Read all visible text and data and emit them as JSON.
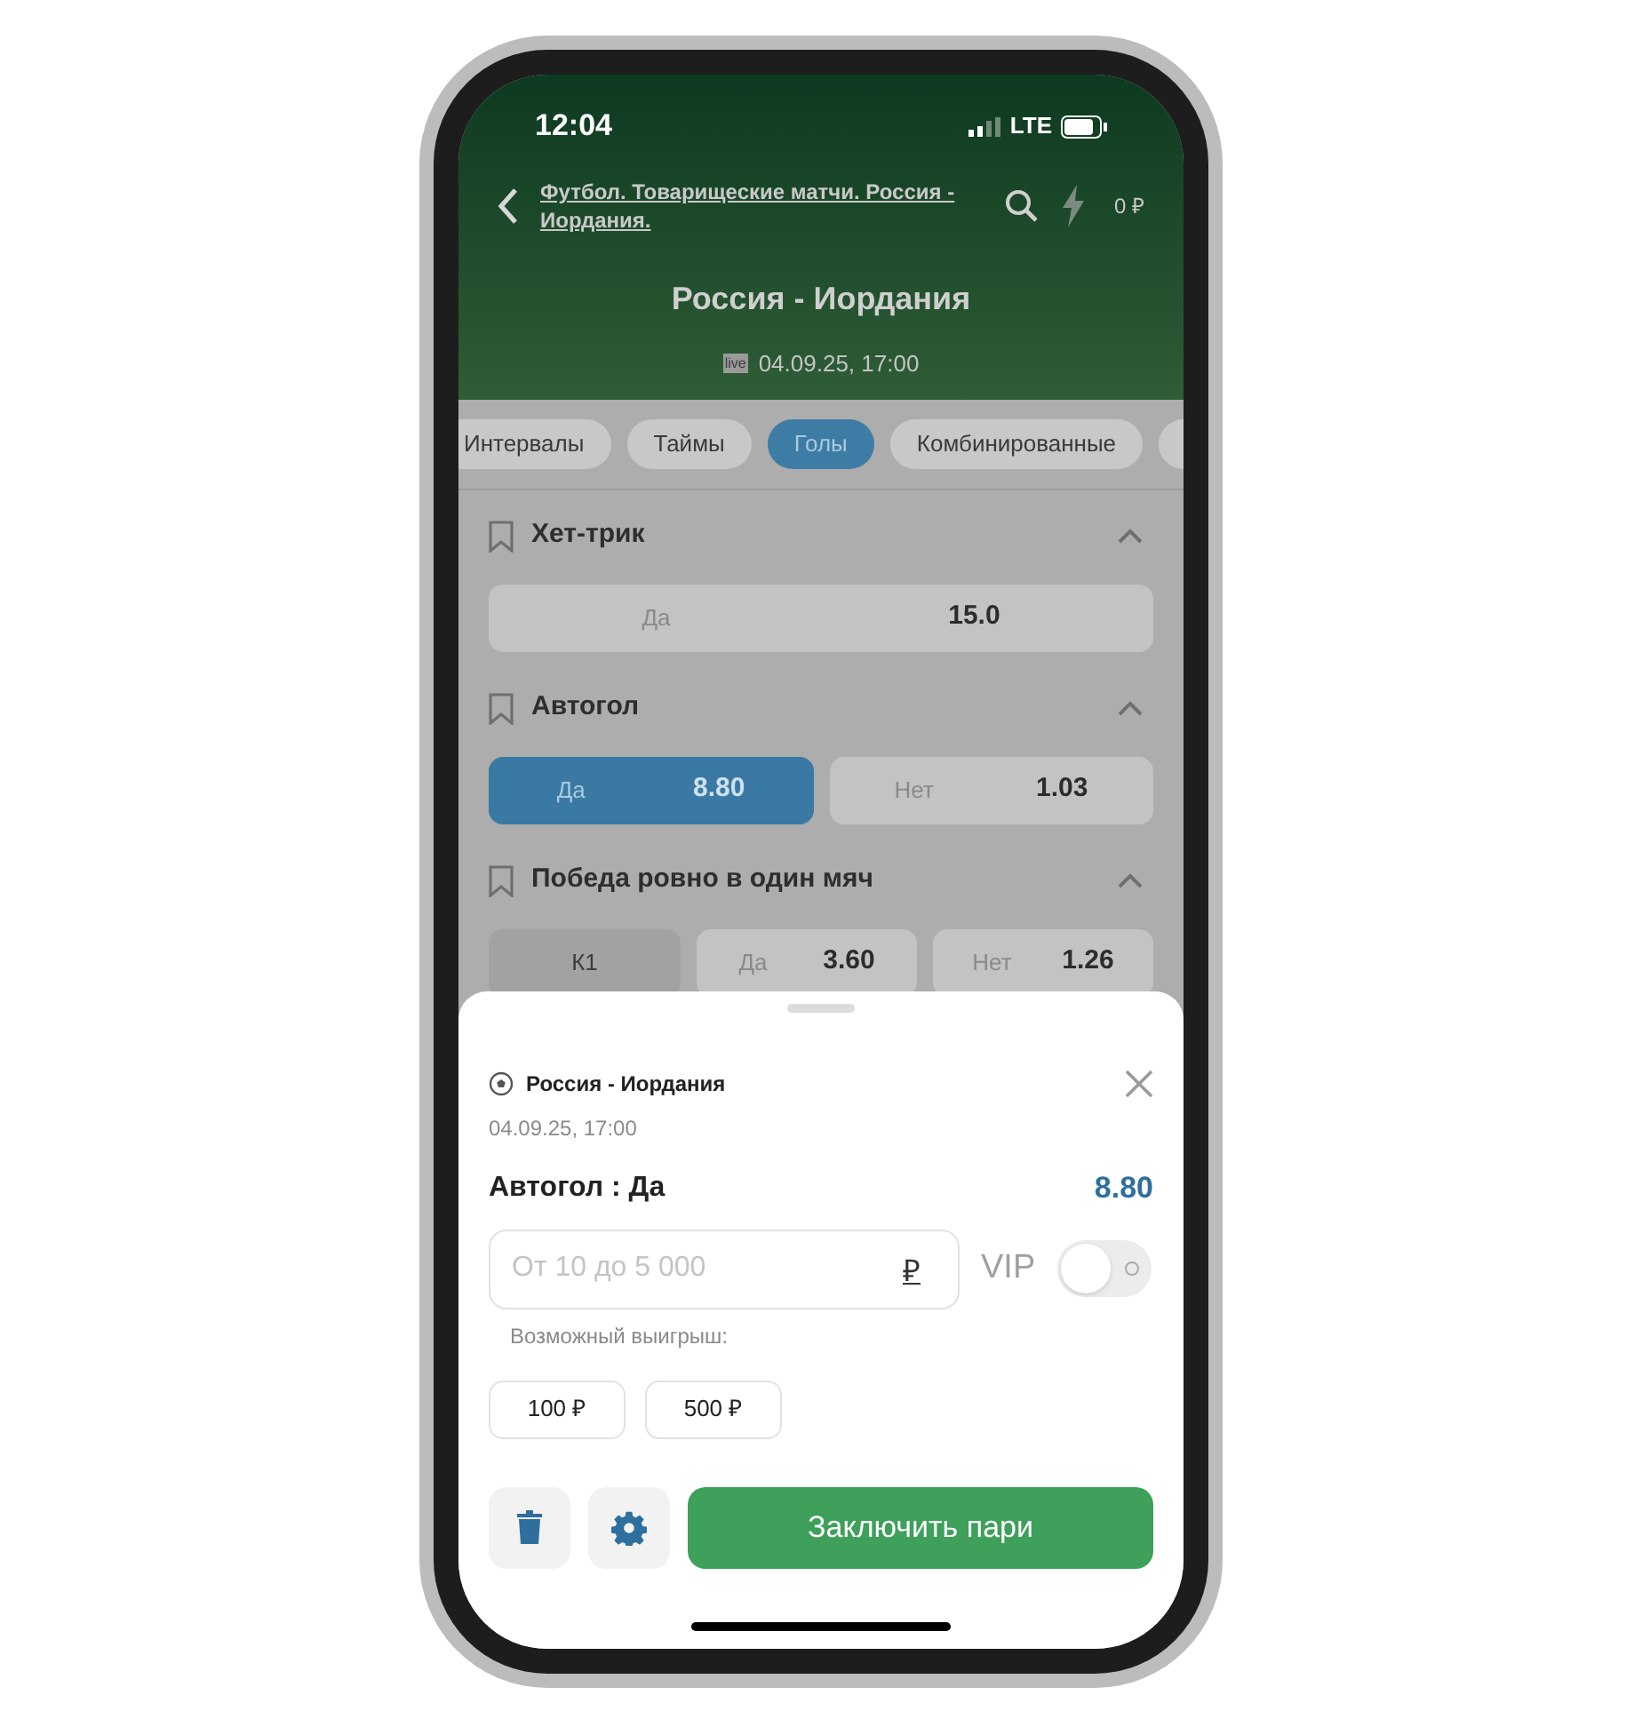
{
  "status_bar": {
    "time": "12:04",
    "network": "LTE"
  },
  "header": {
    "breadcrumb": "Футбол. Товарищеские матчи. Россия - Иордания.",
    "balance": "0 ₽",
    "title": "Россия - Иордания",
    "live_badge": "live",
    "datetime": "04.09.25, 17:00"
  },
  "tabs": [
    {
      "label": "Интервалы",
      "selected": false
    },
    {
      "label": "Таймы",
      "selected": false
    },
    {
      "label": "Голы",
      "selected": true
    },
    {
      "label": "Комбинированные",
      "selected": false
    }
  ],
  "markets": [
    {
      "title": "Хет-трик",
      "expanded": true,
      "outcomes": [
        {
          "kind": "odd",
          "label": "Да",
          "odds": "15.0",
          "selected": false
        }
      ]
    },
    {
      "title": "Автогол",
      "expanded": true,
      "outcomes": [
        {
          "kind": "odd",
          "label": "Да",
          "odds": "8.80",
          "selected": true
        },
        {
          "kind": "odd",
          "label": "Нет",
          "odds": "1.03",
          "selected": false
        }
      ]
    },
    {
      "title": "Победа ровно в один мяч",
      "expanded": true,
      "outcomes": [
        {
          "kind": "header",
          "label": "К1"
        },
        {
          "kind": "odd",
          "label": "Да",
          "odds": "3.60",
          "selected": false
        },
        {
          "kind": "odd",
          "label": "Нет",
          "odds": "1.26",
          "selected": false
        }
      ]
    }
  ],
  "bet_slip": {
    "match": "Россия - Иордания",
    "datetime": "04.09.25, 17:00",
    "selection": "Автогол : Да",
    "odds": "8.80",
    "stake": {
      "placeholder": "От 10 до 5 000",
      "currency": "₽"
    },
    "vip": {
      "label": "VIP",
      "on": false
    },
    "possible_win": "Возможный выигрыш:",
    "quick_amounts": [
      "100 ₽",
      "500 ₽"
    ],
    "submit": "Заключить пари"
  }
}
